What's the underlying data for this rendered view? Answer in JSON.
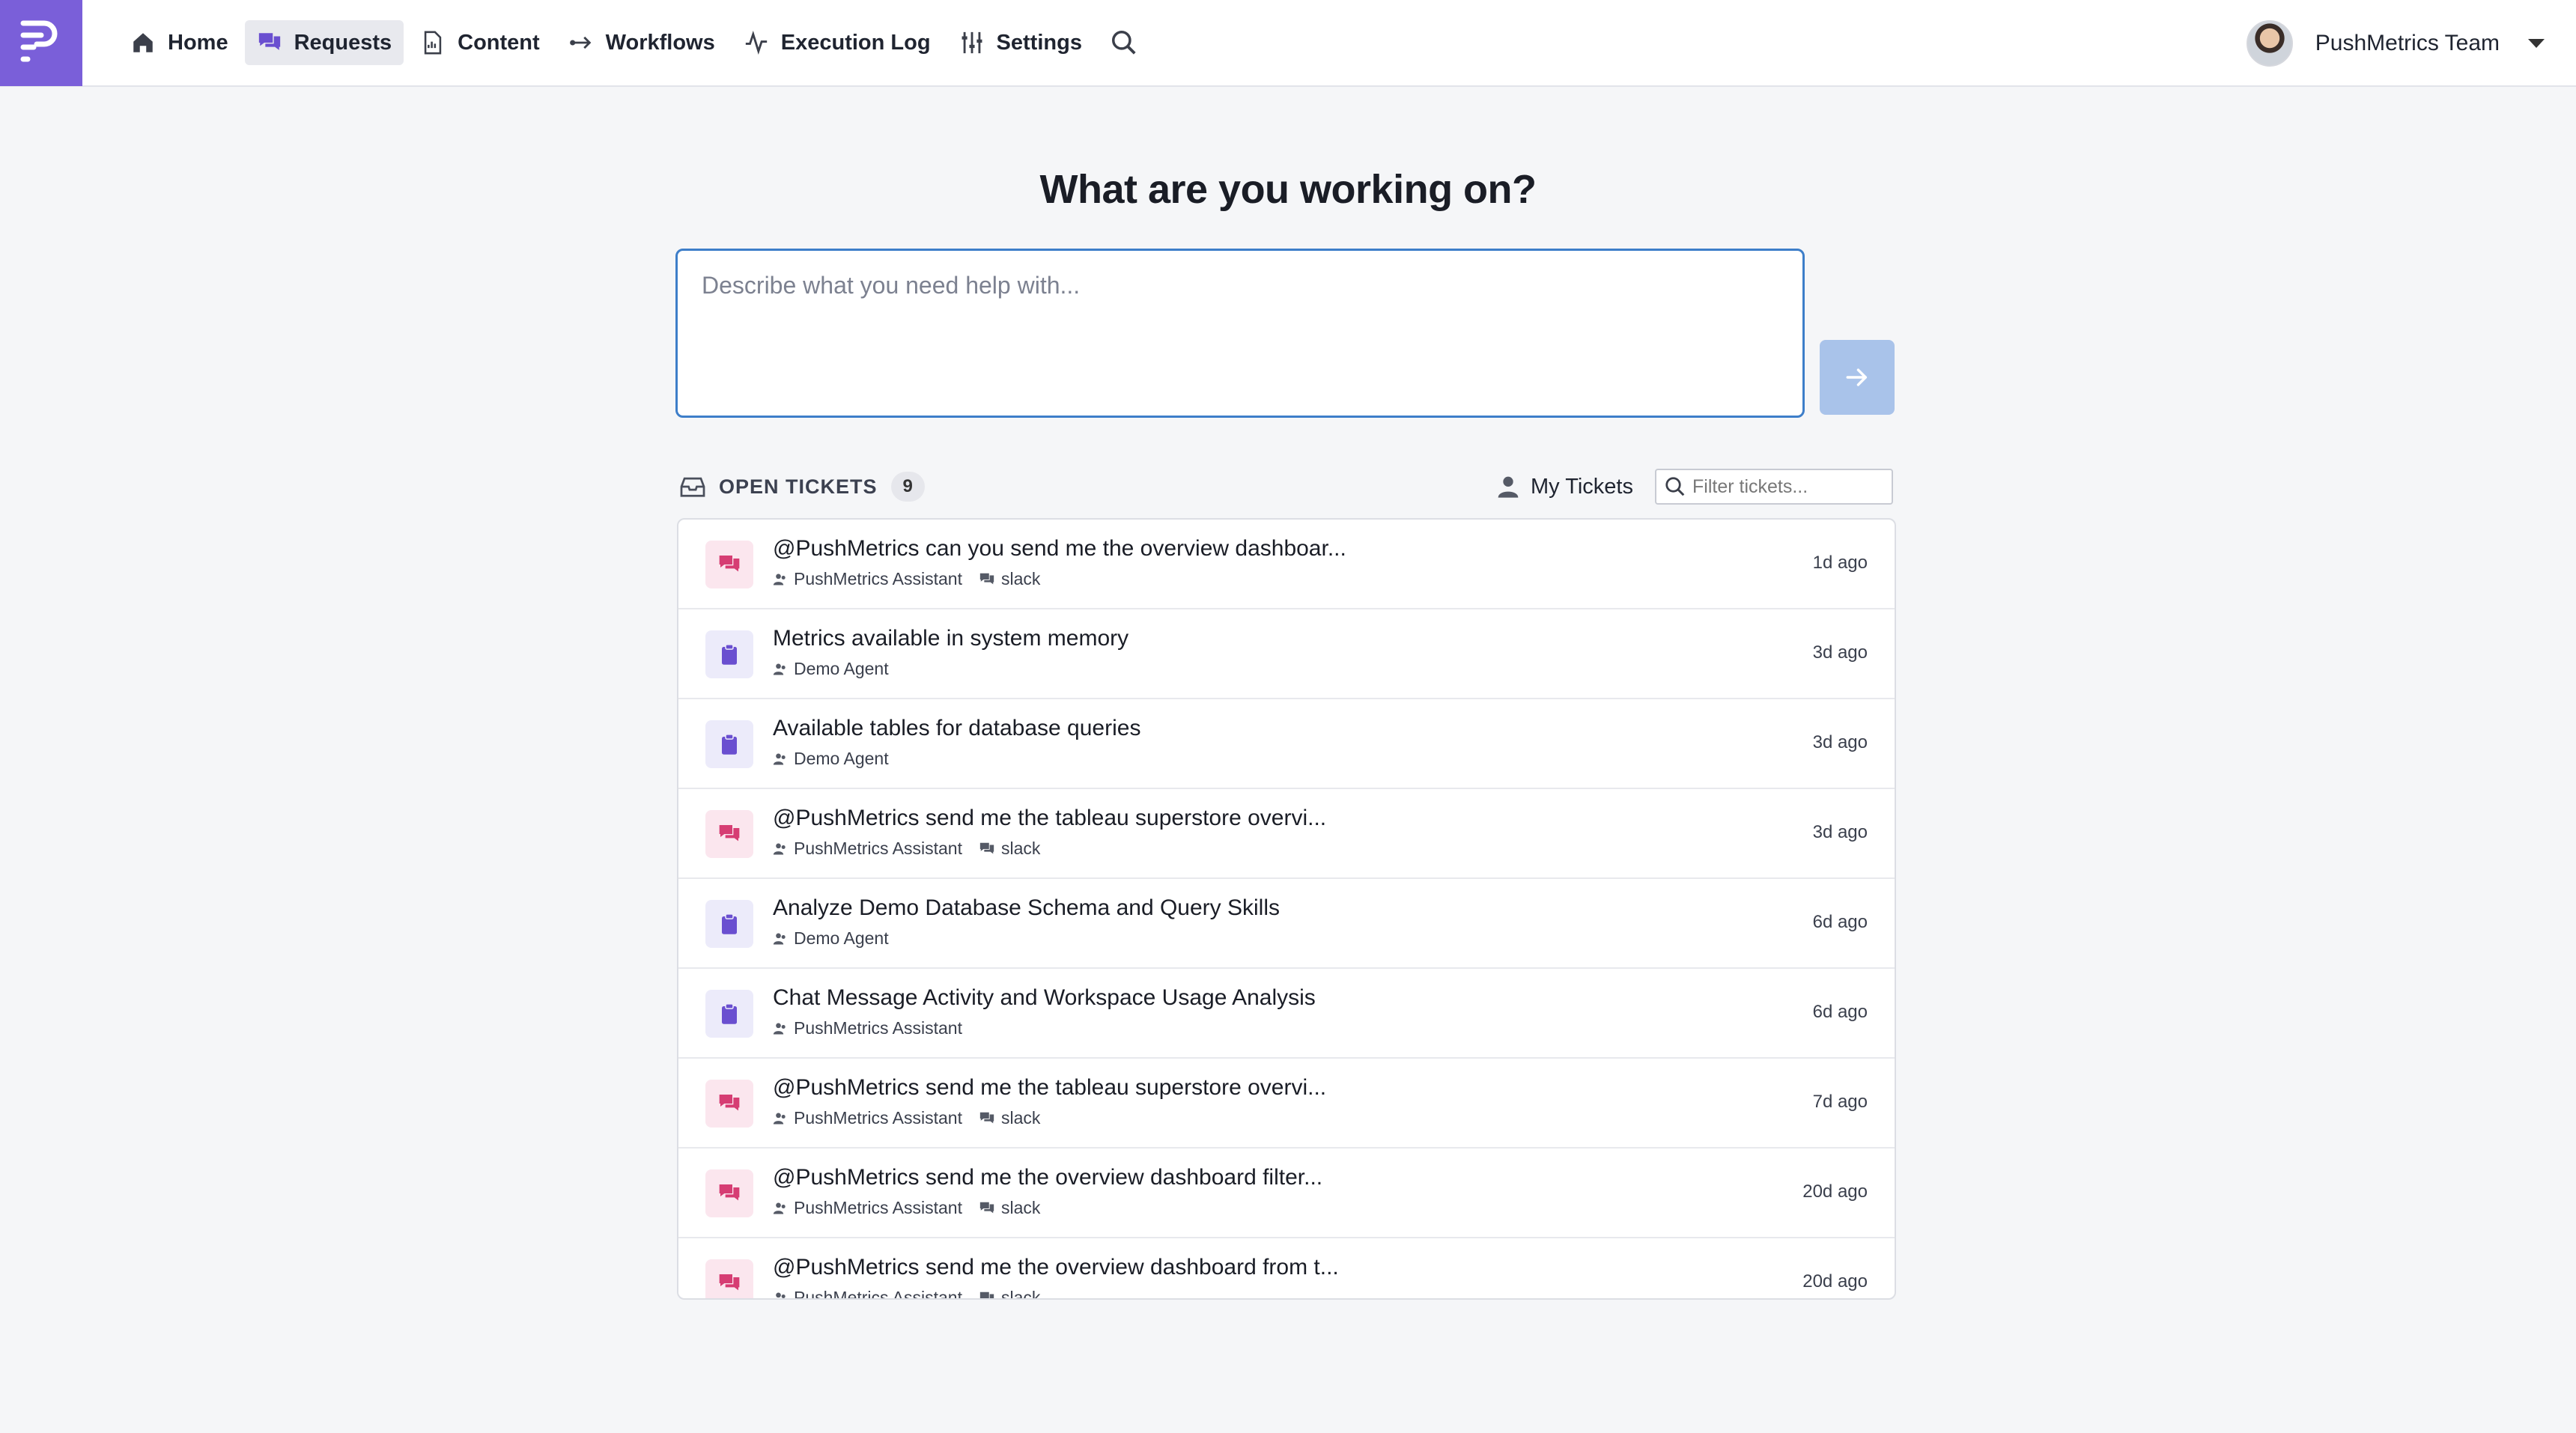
{
  "nav": {
    "items": [
      {
        "label": "Home",
        "icon": "home-icon"
      },
      {
        "label": "Requests",
        "icon": "chat-icon",
        "active": true
      },
      {
        "label": "Content",
        "icon": "document-icon"
      },
      {
        "label": "Workflows",
        "icon": "workflow-icon"
      },
      {
        "label": "Execution Log",
        "icon": "activity-icon"
      },
      {
        "label": "Settings",
        "icon": "sliders-icon"
      }
    ],
    "user_name": "PushMetrics Team",
    "accent": "#7a5fd9"
  },
  "main": {
    "title": "What are you working on?",
    "prompt_placeholder": "Describe what you need help with..."
  },
  "tickets": {
    "header_label": "OPEN TICKETS",
    "count": "9",
    "my_tickets_label": "My Tickets",
    "filter_placeholder": "Filter tickets...",
    "rows": [
      {
        "type": "chat",
        "title": "@PushMetrics can you send me the overview dashboar...",
        "agent": "PushMetrics Assistant",
        "source": "slack",
        "time": "1d ago"
      },
      {
        "type": "task",
        "title": "Metrics available in system memory",
        "agent": "Demo Agent",
        "source": "",
        "time": "3d ago"
      },
      {
        "type": "task",
        "title": "Available tables for database queries",
        "agent": "Demo Agent",
        "source": "",
        "time": "3d ago"
      },
      {
        "type": "chat",
        "title": "@PushMetrics send me the tableau superstore overvi...",
        "agent": "PushMetrics Assistant",
        "source": "slack",
        "time": "3d ago"
      },
      {
        "type": "task",
        "title": "Analyze Demo Database Schema and Query Skills",
        "agent": "Demo Agent",
        "source": "",
        "time": "6d ago"
      },
      {
        "type": "task",
        "title": "Chat Message Activity and Workspace Usage Analysis",
        "agent": "PushMetrics Assistant",
        "source": "",
        "time": "6d ago"
      },
      {
        "type": "chat",
        "title": "@PushMetrics send me the tableau superstore overvi...",
        "agent": "PushMetrics Assistant",
        "source": "slack",
        "time": "7d ago"
      },
      {
        "type": "chat",
        "title": "@PushMetrics send me the overview dashboard filter...",
        "agent": "PushMetrics Assistant",
        "source": "slack",
        "time": "20d ago"
      },
      {
        "type": "chat",
        "title": "@PushMetrics send me the overview dashboard from t...",
        "agent": "PushMetrics Assistant",
        "source": "slack",
        "time": "20d ago"
      }
    ]
  }
}
